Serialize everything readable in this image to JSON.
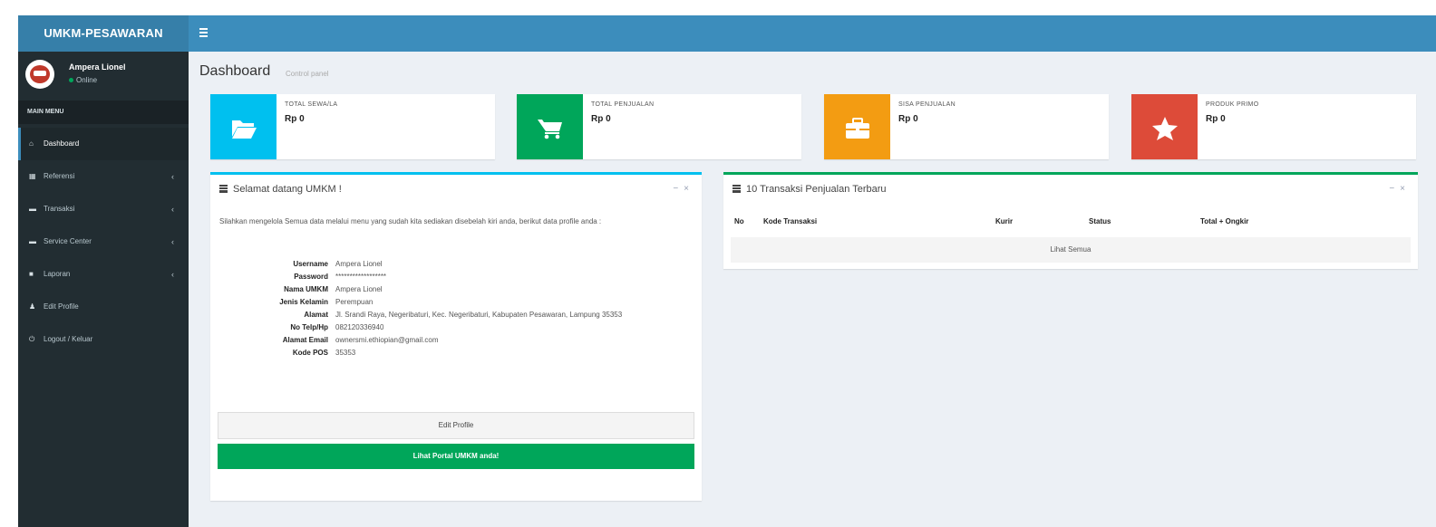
{
  "app": {
    "brand": "UMKM-PESAWARAN",
    "toggle_icon": "hamburger-icon"
  },
  "user": {
    "name": "Ampera Lionel",
    "status": "Online"
  },
  "sidebar": {
    "header": "MAIN MENU",
    "items": [
      {
        "label": "Dashboard",
        "icon": "home-icon",
        "glyph": "⌂",
        "active": true,
        "has_children": false
      },
      {
        "label": "Referensi",
        "icon": "grid-icon",
        "glyph": "▦",
        "active": false,
        "has_children": true
      },
      {
        "label": "Transaksi",
        "icon": "cart-icon",
        "glyph": "▬",
        "active": false,
        "has_children": true
      },
      {
        "label": "Service Center",
        "icon": "cart-icon",
        "glyph": "▬",
        "active": false,
        "has_children": true
      },
      {
        "label": "Laporan",
        "icon": "book-icon",
        "glyph": "■",
        "active": false,
        "has_children": true
      },
      {
        "label": "Edit Profile",
        "icon": "user-icon",
        "glyph": "♟",
        "active": false,
        "has_children": false
      },
      {
        "label": "Logout / Keluar",
        "icon": "power-icon",
        "glyph": "⏻",
        "active": false,
        "has_children": false
      }
    ]
  },
  "page": {
    "title": "Dashboard",
    "subtitle": "Control panel"
  },
  "info_boxes": [
    {
      "label": "TOTAL SEWA/LA",
      "value": "Rp 0",
      "color": "#00c0ef",
      "icon": "folder-open-icon",
      "glyph": "📂"
    },
    {
      "label": "TOTAL PENJUALAN",
      "value": "Rp 0",
      "color": "#00a65a",
      "icon": "cart-icon",
      "glyph": "🛒"
    },
    {
      "label": "SISA PENJUALAN",
      "value": "Rp 0",
      "color": "#f39c12",
      "icon": "briefcase-icon",
      "glyph": "💼"
    },
    {
      "label": "PRODUK PRIMO",
      "value": "Rp 0",
      "color": "#dd4b39",
      "icon": "star-icon",
      "glyph": "★"
    }
  ],
  "welcome_box": {
    "title": "Selamat datang UMKM !",
    "text": "Silahkan mengelola Semua data melalui menu yang sudah kita sediakan disebelah kiri anda, berikut data profile anda :",
    "profile": [
      {
        "label": "Username",
        "value": "Ampera Lionel"
      },
      {
        "label": "Password",
        "value": "******************"
      },
      {
        "label": "Nama UMKM",
        "value": "Ampera Lionel"
      },
      {
        "label": "Jenis Kelamin",
        "value": "Perempuan"
      },
      {
        "label": "Alamat",
        "value": "Jl. Srandi Raya, Negeribaturi, Kec. Negeribaturi, Kabupaten Pesawaran, Lampung 35353"
      },
      {
        "label": "No Telp/Hp",
        "value": "082120336940"
      },
      {
        "label": "Alamat Email",
        "value": "ownersmi.ethiopian@gmail.com"
      },
      {
        "label": "Kode POS",
        "value": "35353"
      }
    ],
    "edit_button": "Edit Profile",
    "portal_button": "Lihat Portal UMKM anda!"
  },
  "transactions_box": {
    "title": "10 Transaksi Penjualan Terbaru",
    "columns": [
      "No",
      "Kode Transaksi",
      "Kurir",
      "Status",
      "Total + Ongkir"
    ],
    "view_all": "Lihat Semua"
  },
  "colors": {
    "header": "#3c8dbc",
    "logo": "#367fa9",
    "sidebar": "#222d32",
    "content_bg": "#ecf0f5"
  }
}
